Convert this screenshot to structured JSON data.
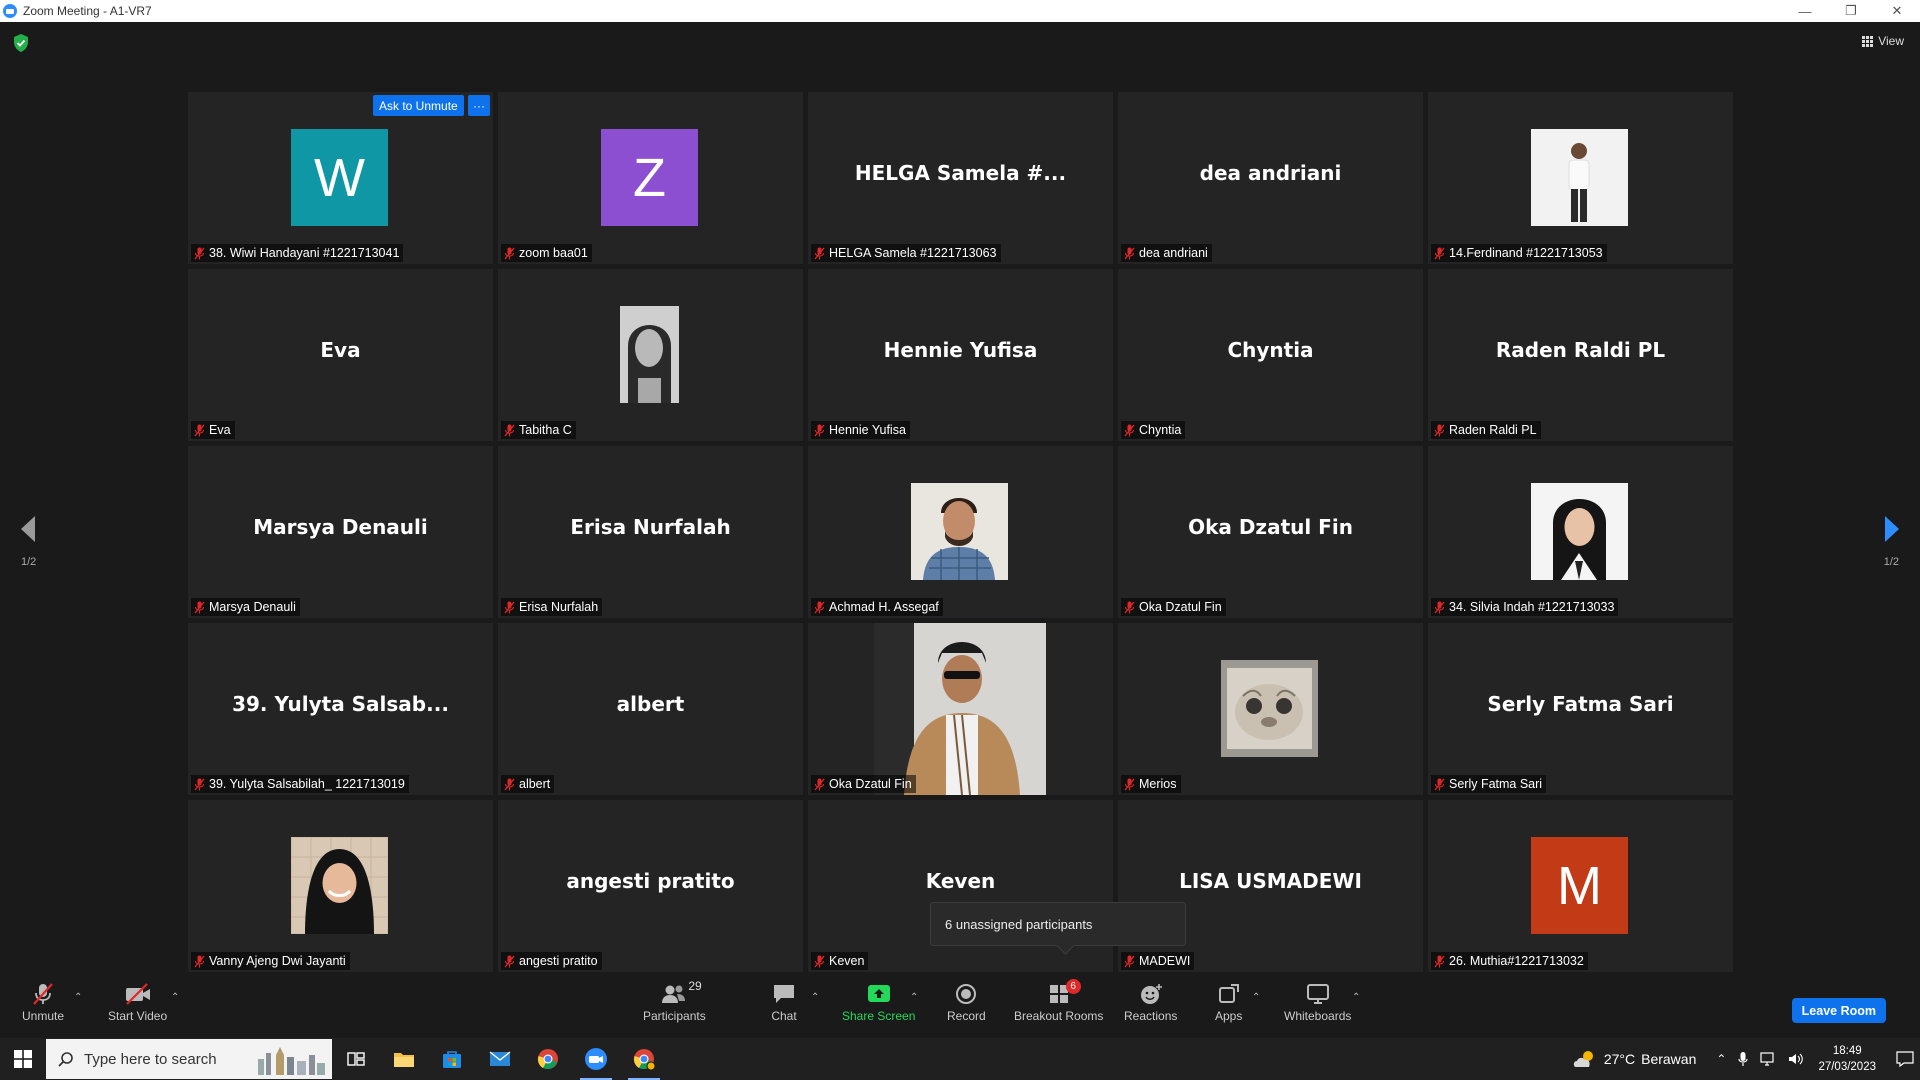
{
  "window": {
    "title": "Zoom Meeting - A1-VR7",
    "controls": [
      "—",
      "❐",
      "✕"
    ]
  },
  "view_label": "View",
  "page_indicator": {
    "left": "1/2",
    "right": "1/2"
  },
  "ask_to_unmute": "Ask to Unmute",
  "ask_more": "···",
  "tooltip": "6 unassigned participants",
  "colors": {
    "accent": "#0e72ed",
    "share_green": "#23d959",
    "muted_red": "#e02828"
  },
  "tiles": [
    {
      "type": "avatar",
      "letter": "W",
      "color": "#0f97a6",
      "name": "38. Wiwi Handayani #1221713041"
    },
    {
      "type": "avatar",
      "letter": "Z",
      "color": "#8c4fd1",
      "name": "zoom baa01"
    },
    {
      "type": "text",
      "display": "HELGA Samela #...",
      "name": "HELGA Samela #1221713063"
    },
    {
      "type": "text",
      "display": "dea andriani",
      "name": "dea andriani"
    },
    {
      "type": "photo",
      "photo": "man-standing",
      "name": "14.Ferdinand #1221713053"
    },
    {
      "type": "text",
      "display": "Eva",
      "name": "Eva"
    },
    {
      "type": "photo",
      "photo": "woman-bw-portrait",
      "name": "Tabitha C"
    },
    {
      "type": "text",
      "display": "Hennie Yufisa",
      "name": "Hennie Yufisa"
    },
    {
      "type": "text",
      "display": "Chyntia",
      "name": "Chyntia"
    },
    {
      "type": "text",
      "display": "Raden Raldi PL",
      "name": "Raden Raldi PL"
    },
    {
      "type": "text",
      "display": "Marsya Denauli",
      "name": "Marsya Denauli"
    },
    {
      "type": "text",
      "display": "Erisa Nurfalah",
      "name": "Erisa Nurfalah"
    },
    {
      "type": "photo",
      "photo": "man-plaid-shirt",
      "name": "Achmad H. Assegaf"
    },
    {
      "type": "text",
      "display": "Oka Dzatul Fin",
      "name": "Oka Dzatul Fin"
    },
    {
      "type": "photo",
      "photo": "woman-hijab-formal",
      "name": "34. Silvia Indah #1221713033"
    },
    {
      "type": "text",
      "display": "39. Yulyta Salsab...",
      "name": "39. Yulyta Salsabilah_ 1221713019"
    },
    {
      "type": "text",
      "display": "albert",
      "name": "albert"
    },
    {
      "type": "photo",
      "photo": "man-jacket-sunglasses",
      "name": "Oka Dzatul Fin"
    },
    {
      "type": "photo",
      "photo": "cat-face",
      "name": "Merios"
    },
    {
      "type": "text",
      "display": "Serly Fatma Sari",
      "name": "Serly Fatma Sari"
    },
    {
      "type": "photo",
      "photo": "woman-hijab-smiling",
      "name": "Vanny Ajeng Dwi Jayanti"
    },
    {
      "type": "text",
      "display": "angesti pratito",
      "name": "angesti pratito"
    },
    {
      "type": "text",
      "display": "Keven",
      "name": "Keven"
    },
    {
      "type": "text",
      "display": "LISA USMADEWI",
      "name": "MADEWI"
    },
    {
      "type": "avatar",
      "letter": "M",
      "color": "#c23b16",
      "name": "26. Muthia#1221713032"
    }
  ],
  "toolbar": {
    "unmute": "Unmute",
    "start_video": "Start Video",
    "participants": "Participants",
    "participants_count": "29",
    "chat": "Chat",
    "share_screen": "Share Screen",
    "record": "Record",
    "breakout_rooms": "Breakout Rooms",
    "breakout_badge": "6",
    "reactions": "Reactions",
    "apps": "Apps",
    "whiteboards": "Whiteboards",
    "leave": "Leave Room"
  },
  "taskbar": {
    "search_placeholder": "Type here to search",
    "temperature": "27°C",
    "weather": "Berawan",
    "time": "18:49",
    "date": "27/03/2023"
  }
}
